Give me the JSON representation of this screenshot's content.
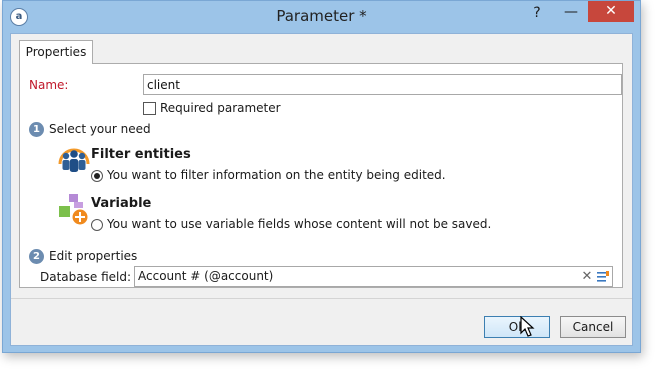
{
  "window": {
    "title": "Parameter *",
    "help_label": "?",
    "minimize_label": "—",
    "close_label": "✕",
    "app_icon_glyph": "a"
  },
  "tabs": [
    {
      "label": "Properties"
    }
  ],
  "form": {
    "name_label": "Name:",
    "name_value": "client",
    "required_label": "Required parameter",
    "step1": {
      "number": "1",
      "label": "Select your need"
    },
    "options": [
      {
        "title": "Filter entities",
        "description": "You want to filter information on the entity being edited.",
        "checked": true,
        "icon": "people-filter-icon"
      },
      {
        "title": "Variable",
        "description": "You want to use variable fields whose content will not be saved.",
        "checked": false,
        "icon": "variable-shapes-icon"
      }
    ],
    "step2": {
      "number": "2",
      "label": "Edit properties"
    },
    "database_field_label": "Database field:",
    "database_field_value": "Account # (@account)",
    "clear_glyph": "✕"
  },
  "buttons": {
    "ok": "Ok",
    "cancel": "Cancel"
  },
  "colors": {
    "accent": "#c7473c",
    "label_red": "#c0182a",
    "step_circle": "#6c8cb0"
  }
}
